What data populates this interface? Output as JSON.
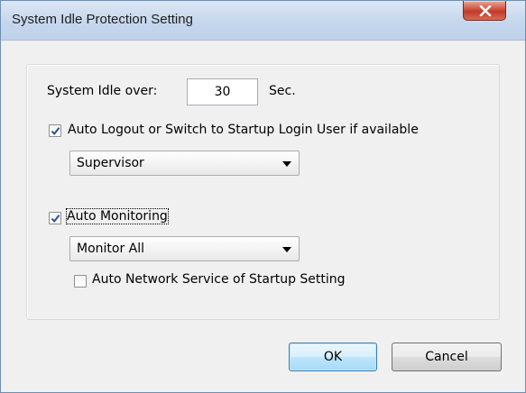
{
  "window": {
    "title": "System Idle Protection Setting"
  },
  "idle": {
    "label": "System Idle over:",
    "value": "30",
    "unit": "Sec."
  },
  "auto_logout": {
    "checked": true,
    "label": "Auto Logout or Switch to Startup Login User if available",
    "user_dropdown": "Supervisor"
  },
  "auto_monitoring": {
    "checked": true,
    "label": "Auto Monitoring",
    "mode_dropdown": "Monitor All"
  },
  "auto_network": {
    "checked": false,
    "label": "Auto Network Service of Startup Setting"
  },
  "buttons": {
    "ok": "OK",
    "cancel": "Cancel"
  },
  "colors": {
    "checkmark": "#2a4f8f",
    "close_button": "#c0392b",
    "default_button_border": "#3c7fb1"
  }
}
